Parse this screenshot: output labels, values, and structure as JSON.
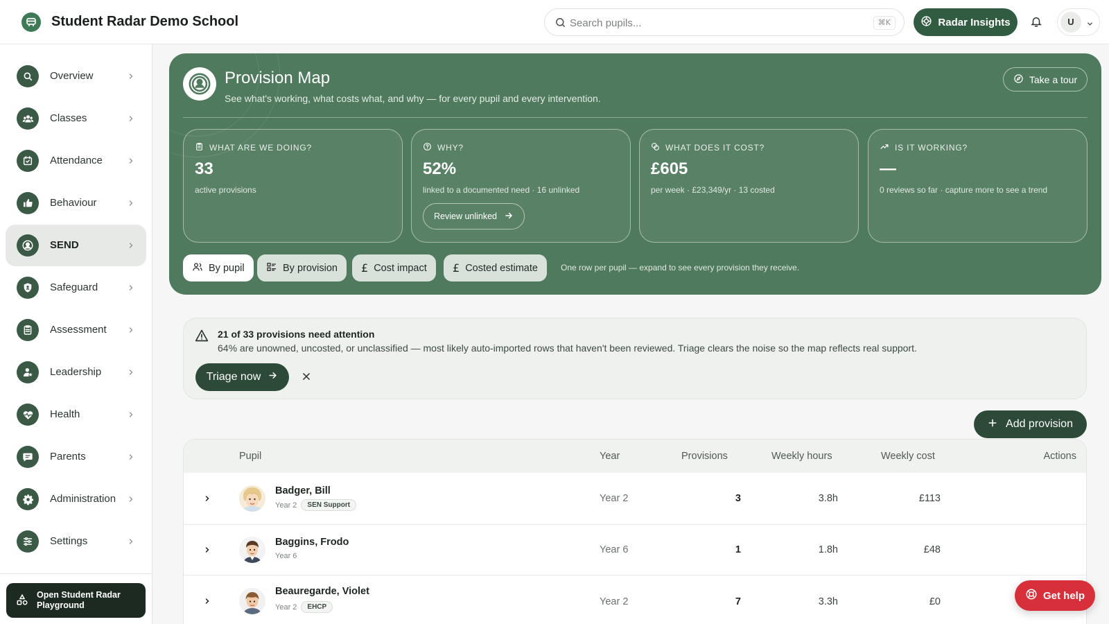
{
  "app": {
    "title": "Student Radar Demo School",
    "search_placeholder": "Search pupils...",
    "search_shortcut": "⌘K",
    "insights_label": "Radar Insights",
    "user_initial": "U"
  },
  "sidebar": {
    "items": [
      {
        "label": "Overview",
        "icon": "search-icon"
      },
      {
        "label": "Classes",
        "icon": "group-icon"
      },
      {
        "label": "Attendance",
        "icon": "calendar-check-icon"
      },
      {
        "label": "Behaviour",
        "icon": "thumbs-up-icon"
      },
      {
        "label": "SEND",
        "icon": "person-circle-icon",
        "active": true
      },
      {
        "label": "Safeguard",
        "icon": "shield-icon"
      },
      {
        "label": "Assessment",
        "icon": "clipboard-icon"
      },
      {
        "label": "Leadership",
        "icon": "person-star-icon"
      },
      {
        "label": "Health",
        "icon": "heart-pulse-icon"
      },
      {
        "label": "Parents",
        "icon": "chat-icon"
      },
      {
        "label": "Administration",
        "icon": "gear-icon"
      },
      {
        "label": "Settings",
        "icon": "sliders-icon"
      }
    ],
    "playground_label": "Open Student Radar Playground"
  },
  "hero": {
    "title": "Provision Map",
    "subtitle": "See what's working, what costs what, and why — for every pupil and every intervention.",
    "tour_label": "Take a tour",
    "cards": [
      {
        "heading": "WHAT ARE WE DOING?",
        "value": "33",
        "desc": "active provisions"
      },
      {
        "heading": "WHY?",
        "value": "52%",
        "desc": "linked to a documented need · 16 unlinked",
        "action": "Review unlinked"
      },
      {
        "heading": "WHAT DOES IT COST?",
        "value": "£605",
        "desc": "per week · £23,349/yr · 13 costed"
      },
      {
        "heading": "IS IT WORKING?",
        "value": "—",
        "desc": "0 reviews so far · capture more to see a trend"
      }
    ],
    "tabs": [
      {
        "label": "By pupil",
        "active": true
      },
      {
        "label": "By provision"
      },
      {
        "label": "Cost impact"
      },
      {
        "label": "Costed estimate"
      }
    ],
    "tab_hint": "One row per pupil — expand to see every provision they receive."
  },
  "attention": {
    "title": "21 of 33 provisions need attention",
    "body": "64% are unowned, uncosted, or unclassified — most likely auto-imported rows that haven't been reviewed. Triage clears the noise so the map reflects real support.",
    "triage_label": "Triage now"
  },
  "add_provision_label": "Add provision",
  "table": {
    "columns": [
      "Pupil",
      "Year",
      "Provisions",
      "Weekly hours",
      "Weekly cost",
      "Actions"
    ],
    "rows": [
      {
        "name": "Badger, Bill",
        "year": "Year 2",
        "tag": "SEN Support",
        "provisions": "3",
        "hours": "3.8h",
        "cost": "£113"
      },
      {
        "name": "Baggins, Frodo",
        "year": "Year 6",
        "tag": "",
        "provisions": "1",
        "hours": "1.8h",
        "cost": "£48"
      },
      {
        "name": "Beauregarde, Violet",
        "year": "Year 2",
        "tag": "EHCP",
        "provisions": "7",
        "hours": "3.3h",
        "cost": "£0"
      }
    ]
  },
  "help_label": "Get help"
}
